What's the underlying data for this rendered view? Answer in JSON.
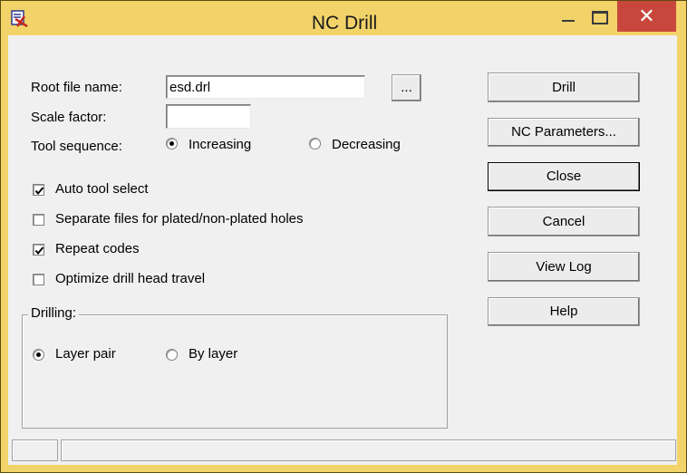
{
  "window": {
    "title": "NC Drill",
    "close_glyph": "✕",
    "icon": "drill-app-icon"
  },
  "form": {
    "root_file_label": "Root file name:",
    "root_file_value": "esd.drl",
    "browse_label": "...",
    "scale_label": "Scale factor:",
    "scale_value": "",
    "tool_sequence_label": "Tool sequence:",
    "tool_sequence_options": [
      "Increasing",
      "Decreasing"
    ],
    "tool_sequence_selected": "Increasing"
  },
  "checkboxes": [
    {
      "label": "Auto tool select",
      "checked": true
    },
    {
      "label": "Separate files for plated/non-plated holes",
      "checked": false
    },
    {
      "label": "Repeat codes",
      "checked": true
    },
    {
      "label": "Optimize drill head travel",
      "checked": false
    }
  ],
  "drilling": {
    "title": "Drilling:",
    "options": [
      "Layer pair",
      "By layer"
    ],
    "selected": "Layer pair"
  },
  "buttons": {
    "drill": "Drill",
    "nc_parameters": "NC Parameters...",
    "close": "Close",
    "cancel": "Cancel",
    "view_log": "View Log",
    "help": "Help"
  }
}
